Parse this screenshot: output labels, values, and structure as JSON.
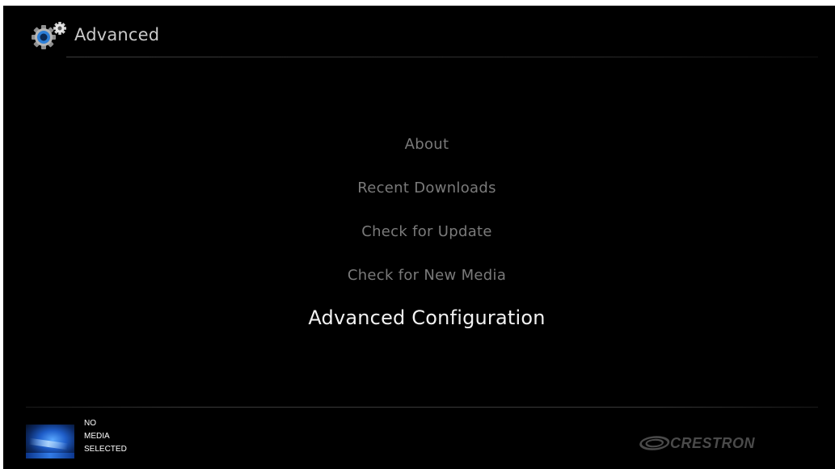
{
  "header": {
    "title": "Advanced",
    "icon": "gears-icon"
  },
  "menu": {
    "items": [
      {
        "label": "About",
        "selected": false
      },
      {
        "label": "Recent Downloads",
        "selected": false
      },
      {
        "label": "Check for Update",
        "selected": false
      },
      {
        "label": "Check for New Media",
        "selected": false
      },
      {
        "label": "Advanced Configuration",
        "selected": true
      }
    ]
  },
  "footer": {
    "media_status": [
      "NO",
      "MEDIA",
      "SELECTED"
    ],
    "brand": "CRESTRON"
  },
  "colors": {
    "background": "#000000",
    "menu_text": "#7a7a7a",
    "selected_text": "#f2f2f2",
    "brand_text": "#4a4a4a"
  }
}
